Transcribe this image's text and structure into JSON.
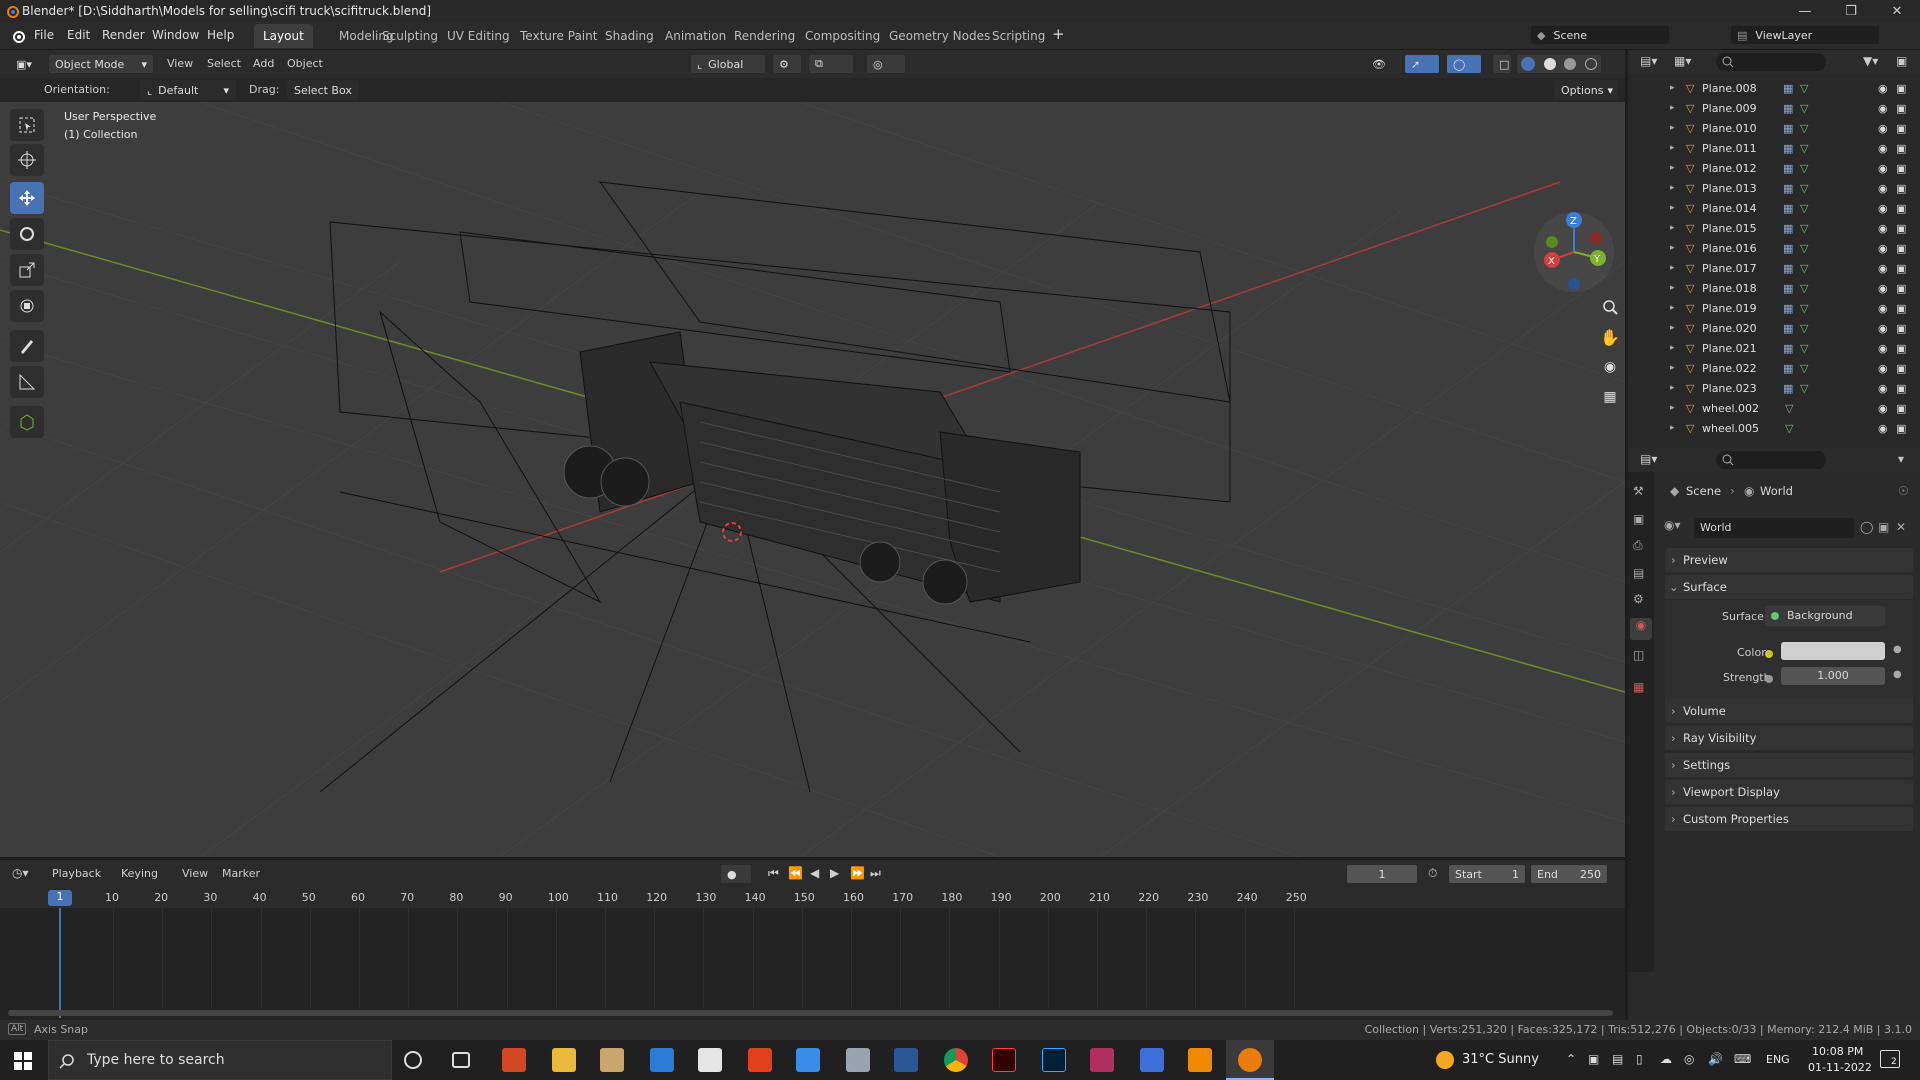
{
  "window": {
    "title": "Blender* [D:\\Siddharth\\Models for selling\\scifi truck\\scifitruck.blend]"
  },
  "menu": [
    "File",
    "Edit",
    "Render",
    "Window",
    "Help"
  ],
  "workspaces": [
    "Layout",
    "Modeling",
    "Sculpting",
    "UV Editing",
    "Texture Paint",
    "Shading",
    "Animation",
    "Rendering",
    "Compositing",
    "Geometry Nodes",
    "Scripting"
  ],
  "active_workspace": "Layout",
  "scene": {
    "label": "Scene",
    "view_layer": "ViewLayer"
  },
  "viewport_header": {
    "mode": "Object Mode",
    "menus": [
      "View",
      "Select",
      "Add",
      "Object"
    ],
    "transform": "Global",
    "options": "Options"
  },
  "viewport_tool": {
    "orientation_label": "Orientation:",
    "orientation_value": "Default",
    "drag_label": "Drag:",
    "drag_value": "Select Box"
  },
  "viewport_overlay": {
    "perspective": "User Perspective",
    "collection": "(1) Collection"
  },
  "gizmo": {
    "x": "X",
    "y": "Y",
    "z": "Z"
  },
  "outliner": {
    "items": [
      {
        "name": "Plane.008"
      },
      {
        "name": "Plane.009"
      },
      {
        "name": "Plane.010"
      },
      {
        "name": "Plane.011"
      },
      {
        "name": "Plane.012"
      },
      {
        "name": "Plane.013"
      },
      {
        "name": "Plane.014"
      },
      {
        "name": "Plane.015"
      },
      {
        "name": "Plane.016"
      },
      {
        "name": "Plane.017"
      },
      {
        "name": "Plane.018"
      },
      {
        "name": "Plane.019"
      },
      {
        "name": "Plane.020"
      },
      {
        "name": "Plane.021"
      },
      {
        "name": "Plane.022"
      },
      {
        "name": "Plane.023"
      },
      {
        "name": "wheel.002"
      },
      {
        "name": "wheel.005"
      }
    ]
  },
  "properties": {
    "breadcrumb_scene": "Scene",
    "breadcrumb_world": "World",
    "world_name": "World",
    "panels": [
      "Preview",
      "Surface",
      "Volume",
      "Ray Visibility",
      "Settings",
      "Viewport Display",
      "Custom Properties"
    ],
    "surface_label": "Surface",
    "surface_value": "Background",
    "color_label": "Color",
    "strength_label": "Strength",
    "strength_value": "1.000"
  },
  "timeline": {
    "menus": [
      "Playback",
      "Keying",
      "View",
      "Marker"
    ],
    "current_frame": "1",
    "start_label": "Start",
    "start": "1",
    "end_label": "End",
    "end": "250",
    "ticks": [
      "10",
      "20",
      "30",
      "40",
      "50",
      "60",
      "70",
      "80",
      "90",
      "100",
      "110",
      "120",
      "130",
      "140",
      "150",
      "160",
      "170",
      "180",
      "190",
      "200",
      "210",
      "220",
      "230",
      "240",
      "250"
    ],
    "cursor": "1"
  },
  "statusbar": {
    "left": "Axis Snap",
    "right": "Collection | Verts:251,320 | Faces:325,172 | Tris:512,276 | Objects:0/33 | Memory: 212.4 MiB | 3.1.0"
  },
  "taskbar": {
    "search_placeholder": "Type here to search",
    "weather": "31°C  Sunny",
    "lang": "ENG",
    "time": "10:08 PM",
    "date": "01-11-2022",
    "notif": "2"
  },
  "colors": {
    "accent": "#4772b3",
    "x_axis": "#d04040",
    "y_axis": "#7fb030",
    "z_axis": "#3a7fd0",
    "object_orange": "#e8a03c",
    "mesh_green": "#6cc07a"
  }
}
